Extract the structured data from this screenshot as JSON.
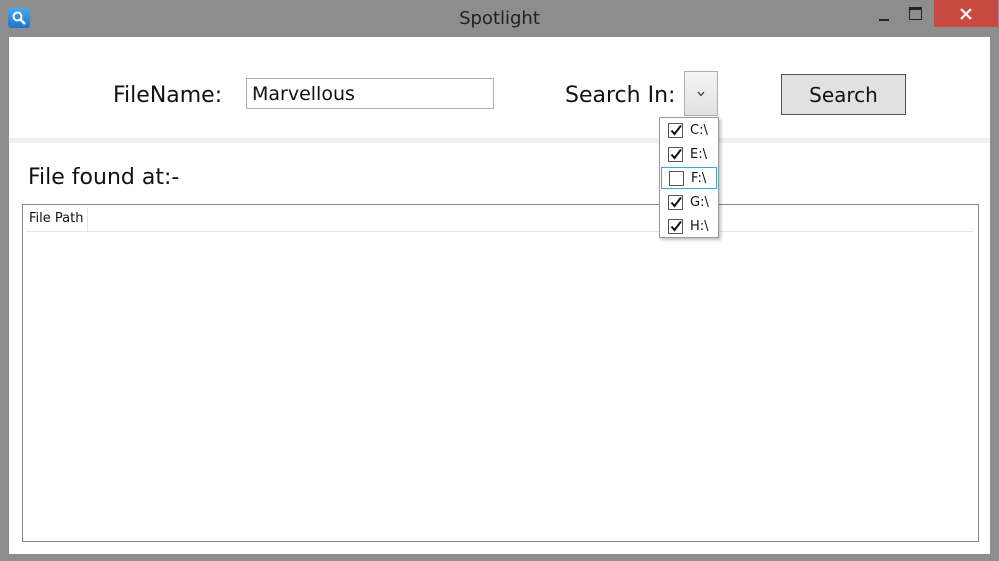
{
  "window": {
    "title": "Spotlight",
    "icon": "magnifier-icon"
  },
  "form": {
    "filename_label": "FileName:",
    "filename_value": "Marvellous",
    "search_in_label": "Search In:",
    "search_button": "Search"
  },
  "results": {
    "label": "File found at:-",
    "columns": [
      "File Path"
    ]
  },
  "drives": [
    {
      "label": "C:\\",
      "checked": true
    },
    {
      "label": "E:\\",
      "checked": true
    },
    {
      "label": "F:\\",
      "checked": false
    },
    {
      "label": "G:\\",
      "checked": true
    },
    {
      "label": "H:\\",
      "checked": true
    }
  ],
  "colors": {
    "close_button": "#c7493f",
    "focus_border": "#3aa9d6"
  }
}
